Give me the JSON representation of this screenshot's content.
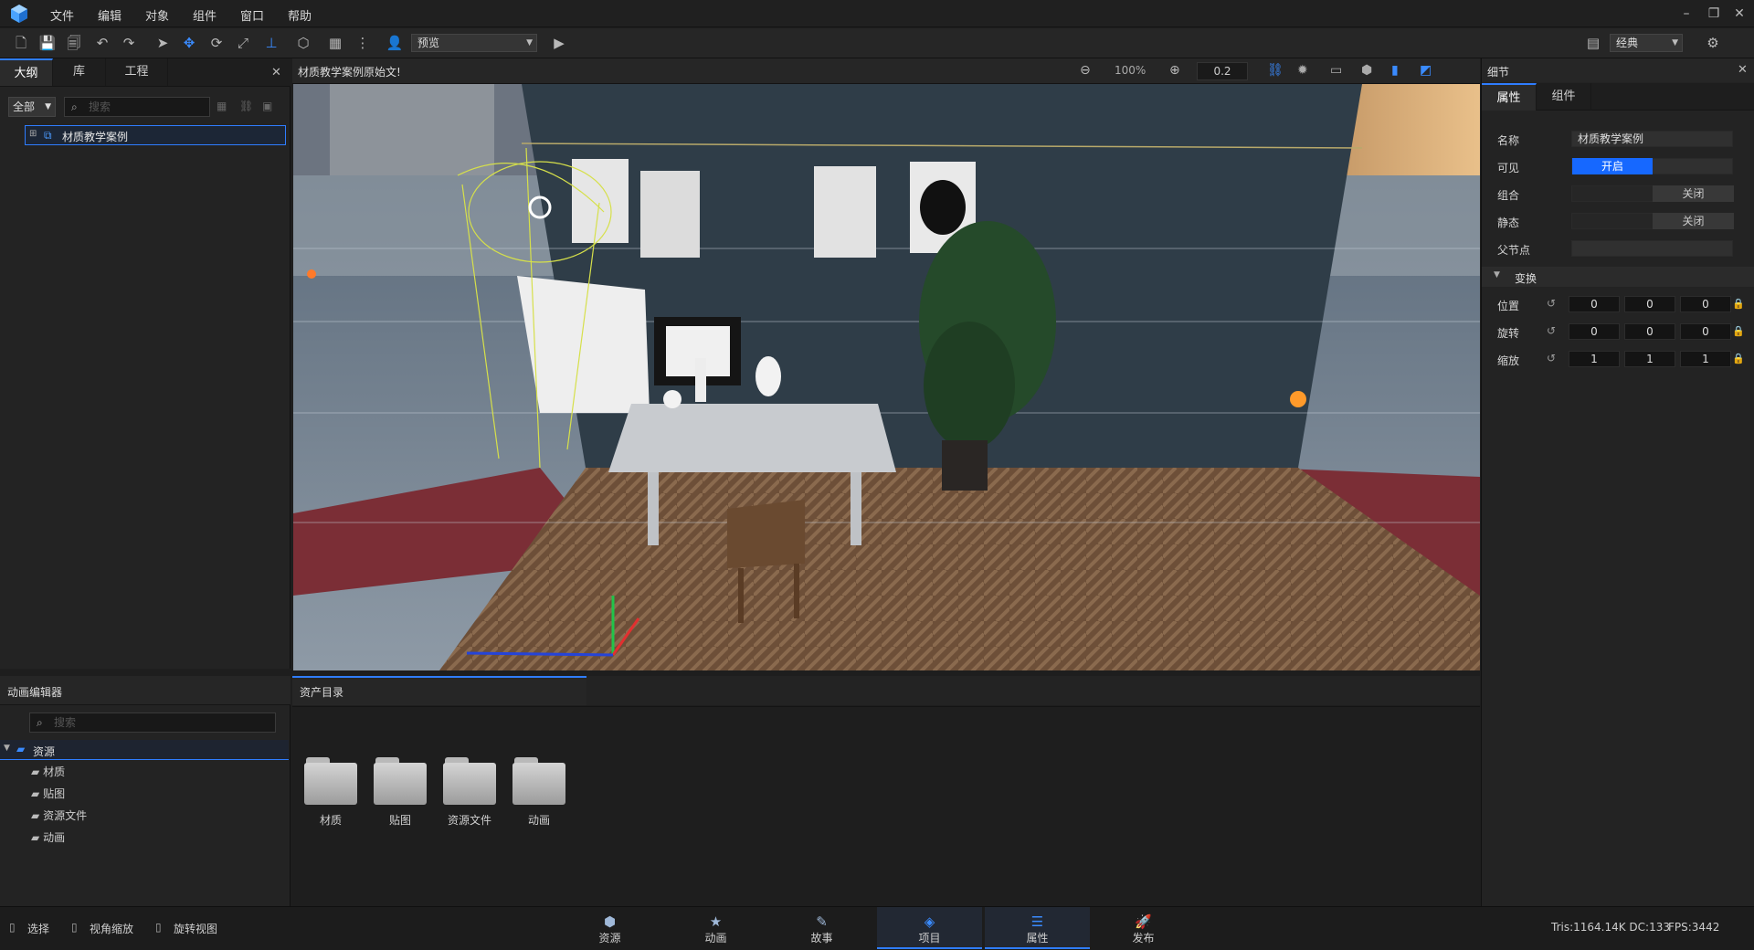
{
  "menu": [
    "文件",
    "编辑",
    "对象",
    "组件",
    "窗口",
    "帮助"
  ],
  "toolbar": {
    "preview_label": "预览",
    "layout_label": "经典"
  },
  "outline": {
    "tabs": [
      "大纲",
      "库",
      "工程"
    ],
    "filter": "全部",
    "search_placeholder": "搜索",
    "tree_item": "材质教学案例"
  },
  "viewport": {
    "title": "材质教学案例原始文!",
    "zoom": "100%",
    "step": "0.2"
  },
  "details": {
    "title": "细节",
    "tabs": [
      "属性",
      "组件"
    ],
    "name_label": "名称",
    "name_value": "材质教学案例",
    "visible_label": "可见",
    "visible_value": "开启",
    "group_label": "组合",
    "group_value": "关闭",
    "static_label": "静态",
    "static_value": "关闭",
    "parent_label": "父节点",
    "transform_label": "变换",
    "position_label": "位置",
    "rotation_label": "旋转",
    "scale_label": "缩放",
    "position": [
      "0",
      "0",
      "0"
    ],
    "rotation": [
      "0",
      "0",
      "0"
    ],
    "scale": [
      "1",
      "1",
      "1"
    ]
  },
  "anim": {
    "title": "动画编辑器",
    "search_placeholder": "搜索",
    "root": "资源",
    "children": [
      "材质",
      "贴图",
      "资源文件",
      "动画"
    ]
  },
  "assets": {
    "title": "资产目录",
    "folders": [
      "材质",
      "贴图",
      "资源文件",
      "动画"
    ]
  },
  "status": {
    "hints": [
      "选择",
      "视角缩放",
      "旋转视图"
    ],
    "modes": [
      "资源",
      "动画",
      "故事",
      "项目",
      "属性",
      "发布"
    ],
    "stats": "Tris:1164.14K  DC:133",
    "fps": "FPS:3442"
  },
  "colors": {
    "accent": "#2f7dff",
    "toggle_on": "#1668ff",
    "bg": "#1e1e1e"
  }
}
